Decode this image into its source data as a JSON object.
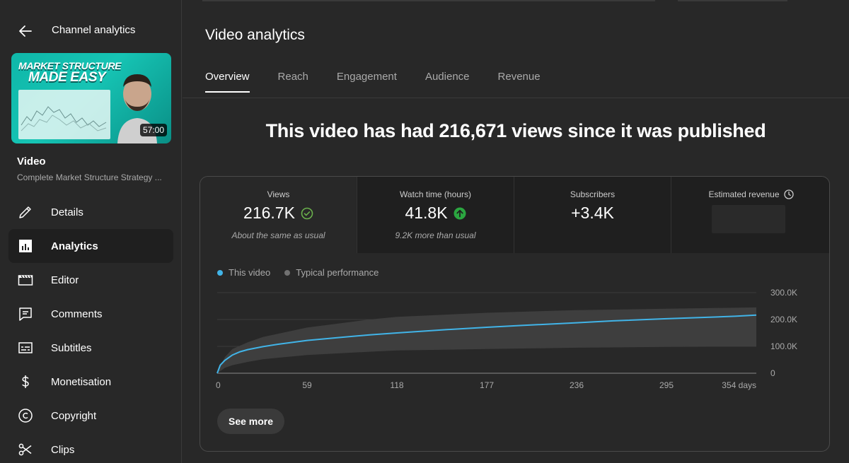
{
  "sidebar": {
    "back_title": "Channel analytics",
    "thumbnail": {
      "line1": "MARKET STRUCTURE",
      "line2": "MADE EASY",
      "duration": "57:00",
      "accent": "#13bfb0"
    },
    "video_label": "Video",
    "video_title": "Complete Market Structure Strategy ...",
    "items": [
      {
        "label": "Details",
        "icon": "pencil-icon"
      },
      {
        "label": "Analytics",
        "icon": "analytics-icon",
        "active": true
      },
      {
        "label": "Editor",
        "icon": "clapperboard-icon"
      },
      {
        "label": "Comments",
        "icon": "comment-icon"
      },
      {
        "label": "Subtitles",
        "icon": "subtitles-icon"
      },
      {
        "label": "Monetisation",
        "icon": "dollar-icon"
      },
      {
        "label": "Copyright",
        "icon": "copyright-icon"
      },
      {
        "label": "Clips",
        "icon": "scissors-icon"
      }
    ]
  },
  "main": {
    "title": "Video analytics",
    "tabs": [
      "Overview",
      "Reach",
      "Engagement",
      "Audience",
      "Revenue"
    ],
    "active_tab": "Overview",
    "headline": "This video has had 216,671 views since it was published"
  },
  "metrics": [
    {
      "label": "Views",
      "value": "216.7K",
      "sub": "About the same as usual",
      "status": "check"
    },
    {
      "label": "Watch time (hours)",
      "value": "41.8K",
      "sub": "9.2K more than usual",
      "status": "up"
    },
    {
      "label": "Subscribers",
      "value": "+3.4K",
      "sub": ""
    },
    {
      "label": "Estimated revenue",
      "value": "",
      "sub": "",
      "icon": "clock-icon"
    }
  ],
  "legend": [
    {
      "label": "This video",
      "color": "#41b4e8"
    },
    {
      "label": "Typical performance",
      "color": "#717171"
    }
  ],
  "chart_data": {
    "type": "line",
    "xlabel": "",
    "ylabel": "",
    "x_ticks": [
      "0",
      "59",
      "118",
      "177",
      "236",
      "295",
      "354 days"
    ],
    "y_ticks": [
      "300.0K",
      "200.0K",
      "100.0K",
      "0"
    ],
    "xlim": [
      0,
      354
    ],
    "ylim": [
      0,
      300000
    ],
    "series": [
      {
        "name": "This video",
        "x": [
          0,
          2,
          5,
          10,
          15,
          20,
          30,
          40,
          59,
          80,
          100,
          118,
          150,
          177,
          200,
          236,
          260,
          295,
          320,
          340,
          354
        ],
        "values": [
          0,
          30000,
          48000,
          68000,
          80000,
          88000,
          99000,
          108000,
          122000,
          133000,
          143000,
          150000,
          162000,
          171000,
          178000,
          188000,
          195000,
          203000,
          208000,
          212000,
          216671
        ]
      }
    ],
    "typical_band": {
      "name": "Typical performance",
      "x": [
        0,
        5,
        10,
        20,
        30,
        59,
        100,
        118,
        177,
        236,
        295,
        354
      ],
      "upper": [
        0,
        60000,
        90000,
        115000,
        135000,
        170000,
        200000,
        210000,
        225000,
        235000,
        240000,
        245000
      ],
      "lower": [
        0,
        20000,
        30000,
        42000,
        52000,
        68000,
        80000,
        85000,
        90000,
        95000,
        98000,
        100000
      ]
    },
    "grid": true
  },
  "see_more_label": "See more"
}
